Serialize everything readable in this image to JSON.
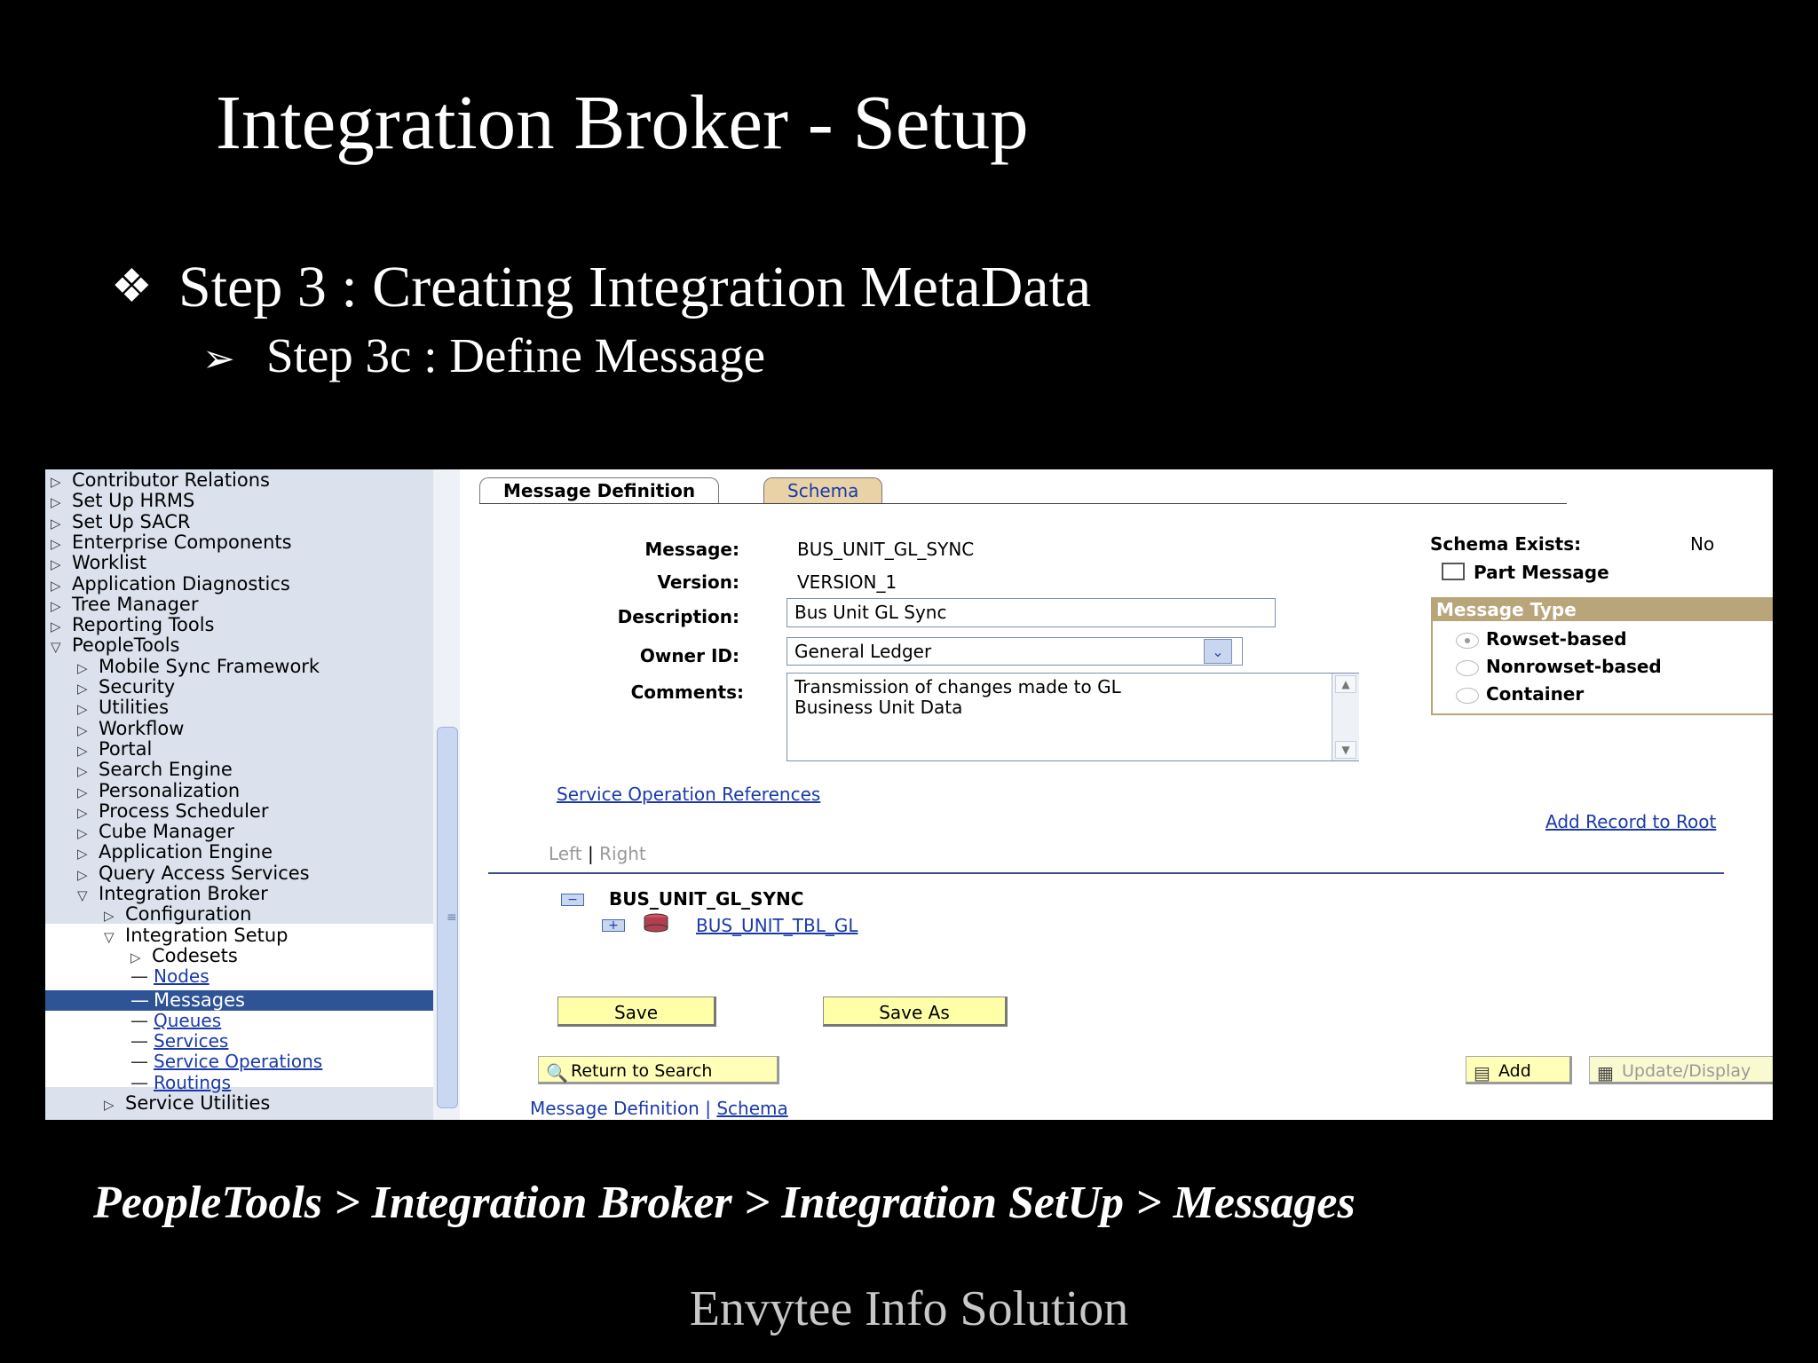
{
  "slide": {
    "title": "Integration Broker - Setup",
    "bullet1_mark": "❖",
    "bullet1": "Step 3 : Creating Integration MetaData",
    "bullet2_mark": "➢",
    "bullet2": "Step 3c : Define Message",
    "caption": "PeopleTools > Integration Broker > Integration SetUp > Messages",
    "footer": "Envytee Info Solution"
  },
  "menu": {
    "items": [
      {
        "label": "Contributor Relations",
        "indent": 0,
        "kind": "collapsed"
      },
      {
        "label": "Set Up HRMS",
        "indent": 0,
        "kind": "collapsed"
      },
      {
        "label": "Set Up SACR",
        "indent": 0,
        "kind": "collapsed"
      },
      {
        "label": "Enterprise Components",
        "indent": 0,
        "kind": "collapsed"
      },
      {
        "label": "Worklist",
        "indent": 0,
        "kind": "collapsed"
      },
      {
        "label": "Application Diagnostics",
        "indent": 0,
        "kind": "collapsed"
      },
      {
        "label": "Tree Manager",
        "indent": 0,
        "kind": "collapsed"
      },
      {
        "label": "Reporting Tools",
        "indent": 0,
        "kind": "collapsed"
      },
      {
        "label": "PeopleTools",
        "indent": 0,
        "kind": "expanded"
      },
      {
        "label": "Mobile Sync Framework",
        "indent": 1,
        "kind": "collapsed"
      },
      {
        "label": "Security",
        "indent": 1,
        "kind": "collapsed"
      },
      {
        "label": "Utilities",
        "indent": 1,
        "kind": "collapsed"
      },
      {
        "label": "Workflow",
        "indent": 1,
        "kind": "collapsed"
      },
      {
        "label": "Portal",
        "indent": 1,
        "kind": "collapsed"
      },
      {
        "label": "Search Engine",
        "indent": 1,
        "kind": "collapsed"
      },
      {
        "label": "Personalization",
        "indent": 1,
        "kind": "collapsed"
      },
      {
        "label": "Process Scheduler",
        "indent": 1,
        "kind": "collapsed"
      },
      {
        "label": "Cube Manager",
        "indent": 1,
        "kind": "collapsed"
      },
      {
        "label": "Application Engine",
        "indent": 1,
        "kind": "collapsed"
      },
      {
        "label": "Query Access Services",
        "indent": 1,
        "kind": "collapsed"
      },
      {
        "label": "Integration Broker",
        "indent": 1,
        "kind": "expanded"
      },
      {
        "label": "Configuration",
        "indent": 2,
        "kind": "collapsed"
      },
      {
        "label": "Integration Setup",
        "indent": 2,
        "kind": "expanded"
      },
      {
        "label": "Codesets",
        "indent": 3,
        "kind": "collapsed"
      },
      {
        "label": "Nodes",
        "indent": 3,
        "kind": "link"
      },
      {
        "label": "Messages",
        "indent": 3,
        "kind": "selected"
      },
      {
        "label": "Queues",
        "indent": 3,
        "kind": "link"
      },
      {
        "label": "Services",
        "indent": 3,
        "kind": "link"
      },
      {
        "label": "Service Operations",
        "indent": 3,
        "kind": "link"
      },
      {
        "label": "Routings",
        "indent": 3,
        "kind": "link"
      },
      {
        "label": "Service Utilities",
        "indent": 2,
        "kind": "collapsed"
      }
    ]
  },
  "tabs": {
    "active": "Message Definition",
    "inactive": "Schema"
  },
  "form": {
    "message_label": "Message:",
    "message_value": "BUS_UNIT_GL_SYNC",
    "version_label": "Version:",
    "version_value": "VERSION_1",
    "description_label": "Description:",
    "description_value": "Bus Unit GL Sync",
    "owner_label": "Owner ID:",
    "owner_value": "General Ledger",
    "comments_label": "Comments:",
    "comments_value": "Transmission of changes made to GL\nBusiness Unit Data",
    "schema_exists_label": "Schema Exists:",
    "schema_exists_value": "No",
    "part_message_label": "Part Message",
    "message_type": {
      "title": "Message Type",
      "options": [
        "Rowset-based",
        "Nonrowset-based",
        "Container"
      ],
      "selected": "Rowset-based"
    }
  },
  "links": {
    "service_op_refs": "Service Operation References",
    "add_record_root": "Add Record to Root",
    "left": "Left",
    "sep": "|",
    "right": "Right"
  },
  "tree": {
    "root": "BUS_UNIT_GL_SYNC",
    "child": "BUS_UNIT_TBL_GL"
  },
  "buttons": {
    "save": "Save",
    "save_as": "Save As",
    "return_to_search": "Return to Search",
    "add": "Add",
    "update_display": "Update/Display"
  },
  "bottom_links": {
    "message_definition": "Message Definition",
    "sep": "|",
    "schema": "Schema"
  },
  "colors": {
    "menu_bg": "#dbe2ee",
    "selected_bg": "#2f5496",
    "link": "#1b3aa8",
    "schema_tab": "#e9d3a6",
    "button_yellow": "#ffffa8",
    "group_border": "#b8a57a"
  }
}
